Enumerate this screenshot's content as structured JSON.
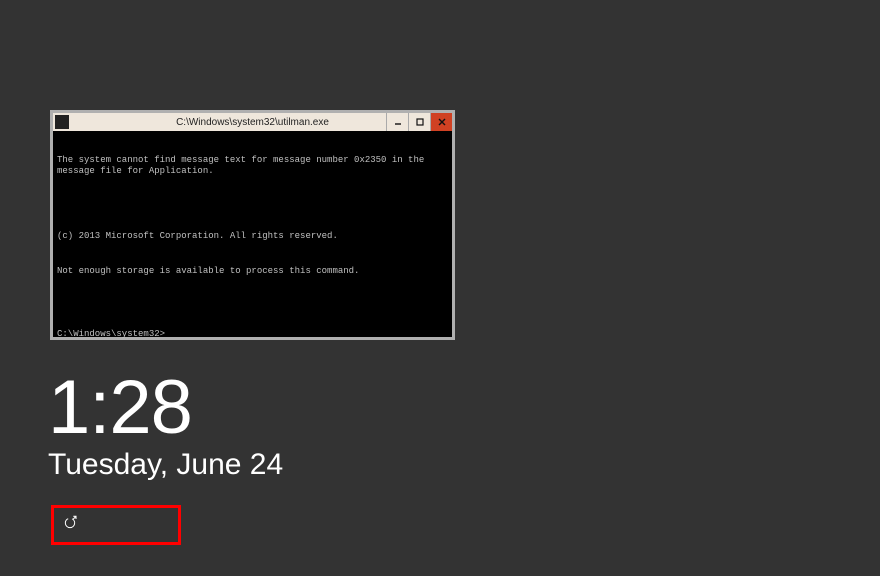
{
  "console": {
    "title": "C:\\Windows\\system32\\utilman.exe",
    "line1": "The system cannot find message text for message number 0x2350 in the message file for Application.",
    "line2": "(c) 2013 Microsoft Corporation. All rights reserved.",
    "line3": "Not enough storage is available to process this command.",
    "prompt": "C:\\Windows\\system32>"
  },
  "lockscreen": {
    "time": "1:28",
    "date": "Tuesday, June 24"
  }
}
